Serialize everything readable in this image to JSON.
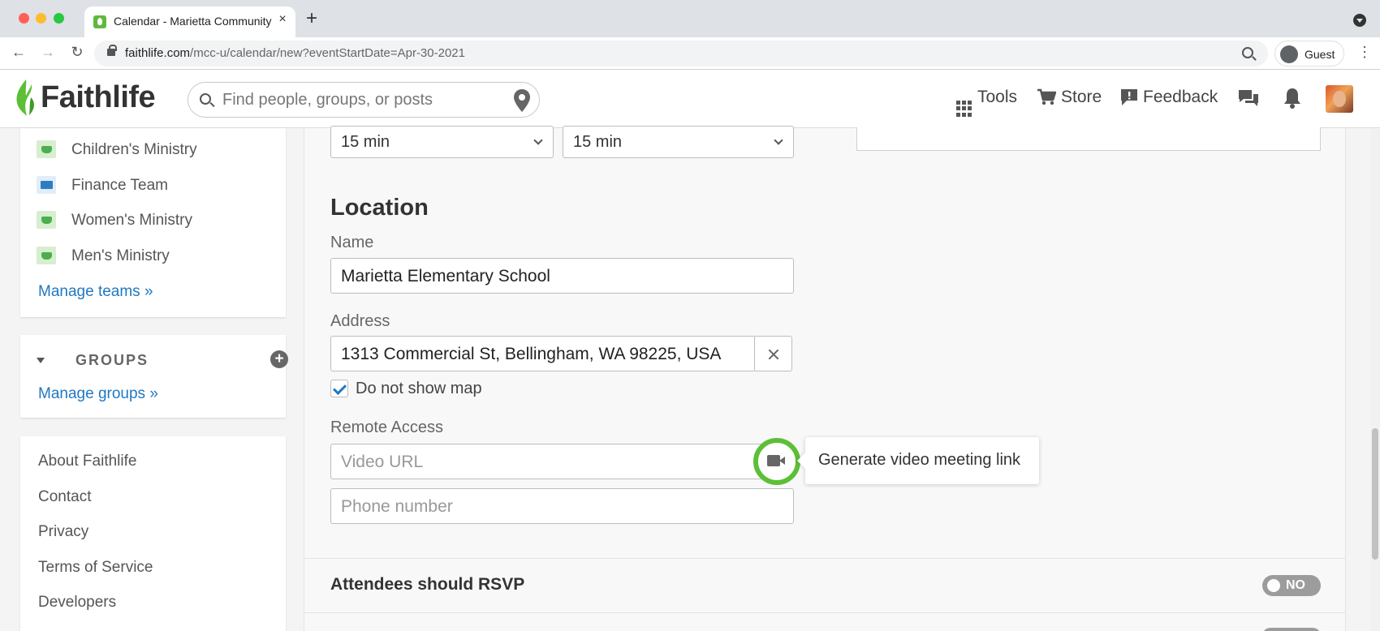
{
  "browser": {
    "tab_title": "Calendar - Marietta Community",
    "tab_close": "×",
    "new_tab": "+",
    "url_host": "faithlife.com",
    "url_path": "/mcc-u/calendar/new?eventStartDate=Apr-30-2021",
    "profile_label": "Guest",
    "menu": "⋮",
    "back": "←",
    "forward": "→",
    "reload": "↻"
  },
  "header": {
    "logo_text": "Faithlife",
    "search_placeholder": "Find people, groups, or posts",
    "nav": [
      {
        "label": "Tools",
        "icon": "grid-icon"
      },
      {
        "label": "Store",
        "icon": "cart-icon"
      },
      {
        "label": "Feedback",
        "icon": "feedback-icon"
      }
    ],
    "icons": [
      "chat-icon",
      "bell-icon",
      "avatar"
    ]
  },
  "sidebar": {
    "teams": [
      {
        "label": "Children's Ministry",
        "icon": "team-icon"
      },
      {
        "label": "Finance Team",
        "icon": "card-icon"
      },
      {
        "label": "Women's Ministry",
        "icon": "team-icon"
      },
      {
        "label": "Men's Ministry",
        "icon": "team-icon"
      }
    ],
    "manage_teams": "Manage teams »",
    "groups_title": "GROUPS",
    "groups_add": "+",
    "manage_groups": "Manage groups »",
    "footer_links": [
      "About Faithlife",
      "Contact",
      "Privacy",
      "Terms of Service",
      "Developers"
    ]
  },
  "form": {
    "reminder_1": "15 min",
    "reminder_2": "15 min",
    "location_heading": "Location",
    "name_label": "Name",
    "name_value": "Marietta Elementary School",
    "address_label": "Address",
    "address_value": "1313 Commercial St, Bellingham, WA 98225, USA",
    "do_not_show_map_label": "Do not show map",
    "do_not_show_map_checked": true,
    "remote_access_label": "Remote Access",
    "video_url_placeholder": "Video URL",
    "phone_placeholder": "Phone number",
    "video_tooltip": "Generate video meeting link",
    "rsvp_label": "Attendees should RSVP",
    "rsvp_toggle": "NO"
  },
  "colors": {
    "brand_green": "#5cbf37",
    "link_blue": "#1f78c1"
  }
}
